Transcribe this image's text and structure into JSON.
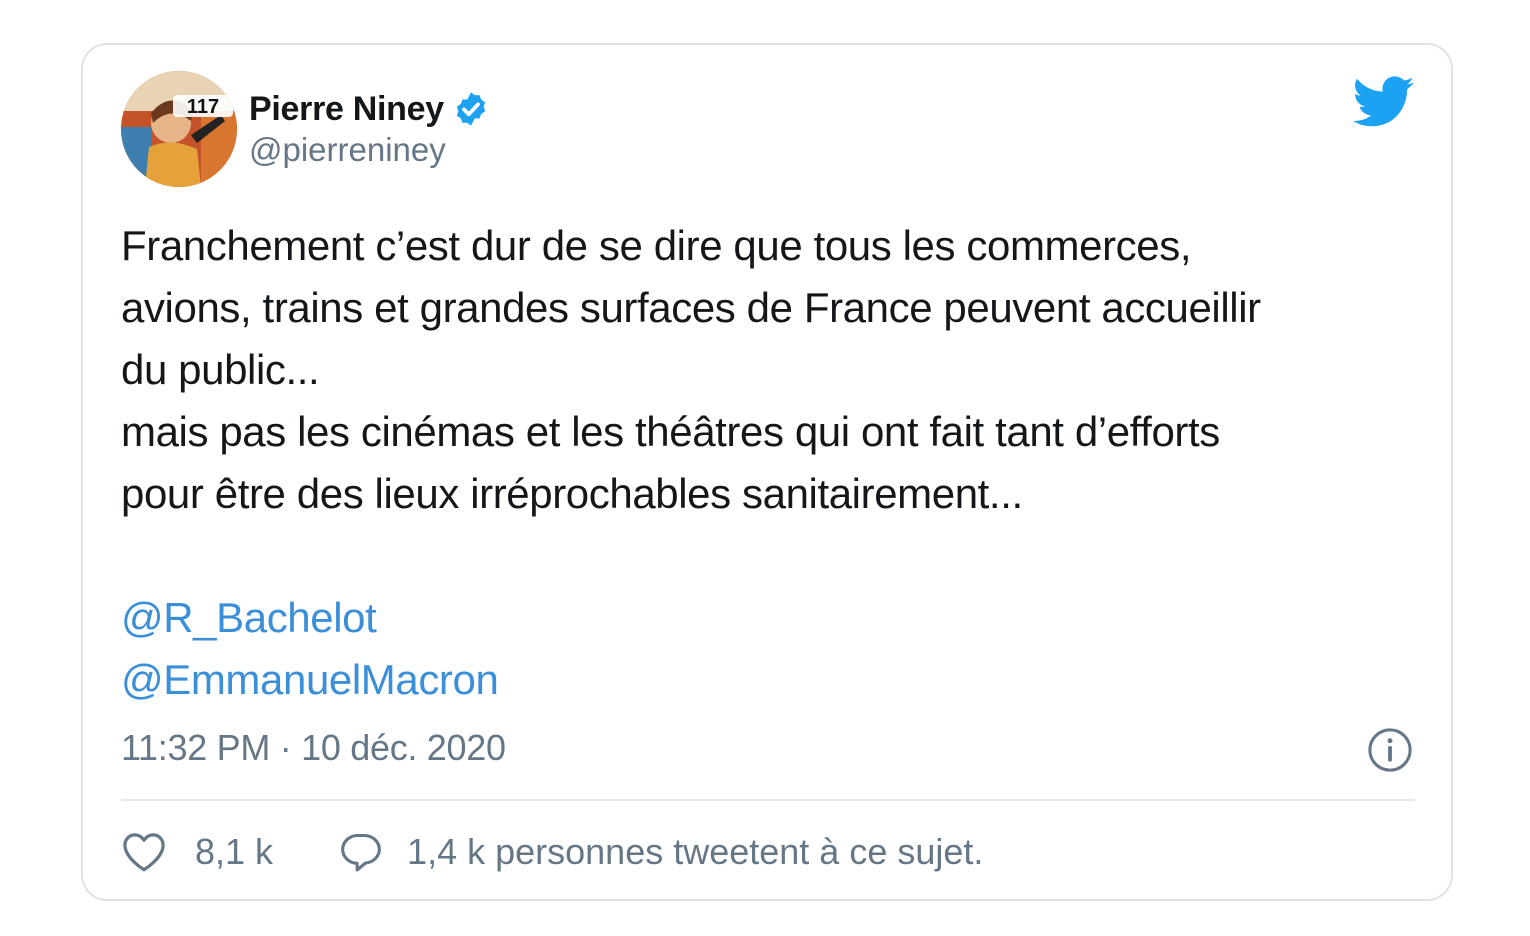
{
  "tweet": {
    "author": {
      "display_name": "Pierre Niney",
      "handle": "@pierreniney",
      "verified": true,
      "avatar_badge": "117"
    },
    "text_lines": [
      "Franchement c’est dur de se dire que tous les commerces,",
      "avions, trains et grandes surfaces de France peuvent accueillir",
      "du public...",
      "mais pas les cinémas et les théâtres qui ont fait tant d’efforts",
      "pour être des lieux irréprochables sanitairement..."
    ],
    "mentions": [
      "@R_Bachelot",
      "@EmmanuelMacron"
    ],
    "timestamp": "11:32 PM · 10 déc. 2020",
    "likes": "8,1 k",
    "conversation": "1,4 k personnes tweetent à ce sujet."
  },
  "icons": {
    "brand": "twitter-bird-icon",
    "verified": "verified-badge-icon",
    "info": "info-icon",
    "like": "heart-icon",
    "reply": "speech-bubble-icon"
  },
  "colors": {
    "twitter_blue": "#1da1f2",
    "mention": "#3b8fd9",
    "text": "#14171a",
    "secondary": "#657786",
    "border": "#dfe3e7"
  }
}
